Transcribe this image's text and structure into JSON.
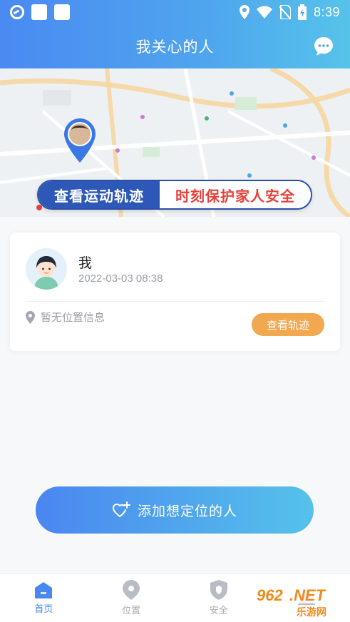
{
  "status_bar": {
    "time": "8:39"
  },
  "header": {
    "title": "我关心的人",
    "message_icon": "chat-bubble-icon"
  },
  "map": {
    "banner_left": "查看运动轨迹",
    "banner_right": "时刻保护家人安全"
  },
  "member_card": {
    "name": "我",
    "timestamp": "2022-03-03 08:38",
    "location_text": "暂无位置信息",
    "track_button": "查看轨迹"
  },
  "add_button": {
    "label": "添加想定位的人"
  },
  "tabbar": {
    "items": [
      {
        "label": "首页",
        "icon": "home-icon",
        "active": true
      },
      {
        "label": "位置",
        "icon": "location-pin-icon",
        "active": false
      },
      {
        "label": "安全",
        "icon": "shield-icon",
        "active": false
      },
      {
        "label": "",
        "icon": "profile-icon",
        "active": false
      }
    ]
  },
  "watermark": {
    "logo_text": "962.NET",
    "sub_text": "乐游网"
  },
  "colors": {
    "brand_blue": "#4a8af2",
    "brand_cyan": "#56c3ea",
    "accent_orange": "#f2a84e",
    "banner_red": "#e8413b"
  }
}
